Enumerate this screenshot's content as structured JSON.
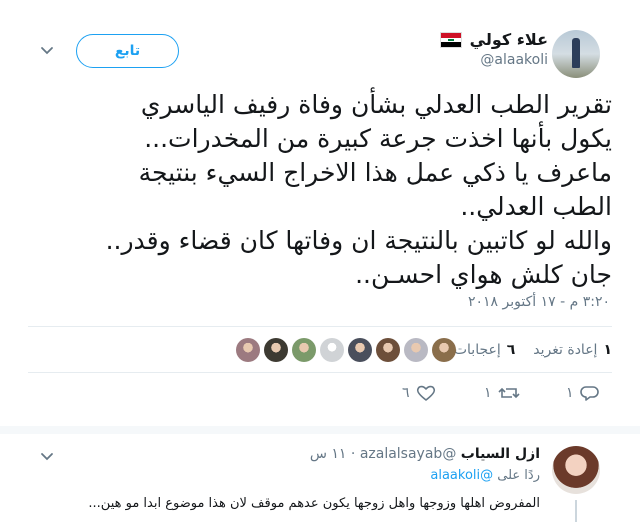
{
  "author": {
    "name": "علاء كولي",
    "handle": "@alaakoli"
  },
  "follow_label": "تابع",
  "tweet_lines": [
    "تقرير الطب العدلي بشأن وفاة رفيف الياسري",
    "يكول بأنها اخذت جرعة كبيرة من المخدرات...",
    "ماعرف يا ذكي عمل هذا الاخراج السيء بنتيجة",
    "الطب العدلي..",
    "والله لو كاتبين بالنتيجة ان وفاتها كان قضاء وقدر..",
    "جان كلش هواي احسـن.."
  ],
  "timestamp": "٣:٢٠ م - ١٧ أكتوبر ٢٠١٨",
  "stats": {
    "retweet_count": "١",
    "retweet_label": "إعادة تغريد",
    "like_count": "٦",
    "like_label": "إعجابات"
  },
  "likers": [
    {
      "color": "#8a6e4b",
      "icon": "avatar-icon"
    },
    {
      "color": "#b9b9c3",
      "icon": "avatar-icon"
    },
    {
      "color": "#6d4f3a",
      "icon": "avatar-icon"
    },
    {
      "color": "#4a4f5c",
      "icon": "avatar-icon"
    },
    {
      "color": "#d0d3d6",
      "icon": "default-avatar-icon"
    },
    {
      "color": "#7b9a6a",
      "icon": "avatar-icon"
    },
    {
      "color": "#3d3a32",
      "icon": "avatar-icon"
    },
    {
      "color": "#9c7a80",
      "icon": "avatar-icon"
    }
  ],
  "actions": {
    "reply_count": "١",
    "retweet_count": "١",
    "like_count": "٦"
  },
  "reply": {
    "name": "ازل السياب",
    "handle": "@azalalsayab",
    "time": "١١ س",
    "replying_label": "ردًا على",
    "replying_to": "@alaakoli",
    "text": "المفروض اهلها وزوجها واهل زوجها يكون عدهم موقف لان هذا موضوع ابدا مو هين..."
  },
  "colors": {
    "accent": "#1da1f2",
    "muted": "#657786",
    "text": "#14171a",
    "border": "#e6ecf0"
  }
}
